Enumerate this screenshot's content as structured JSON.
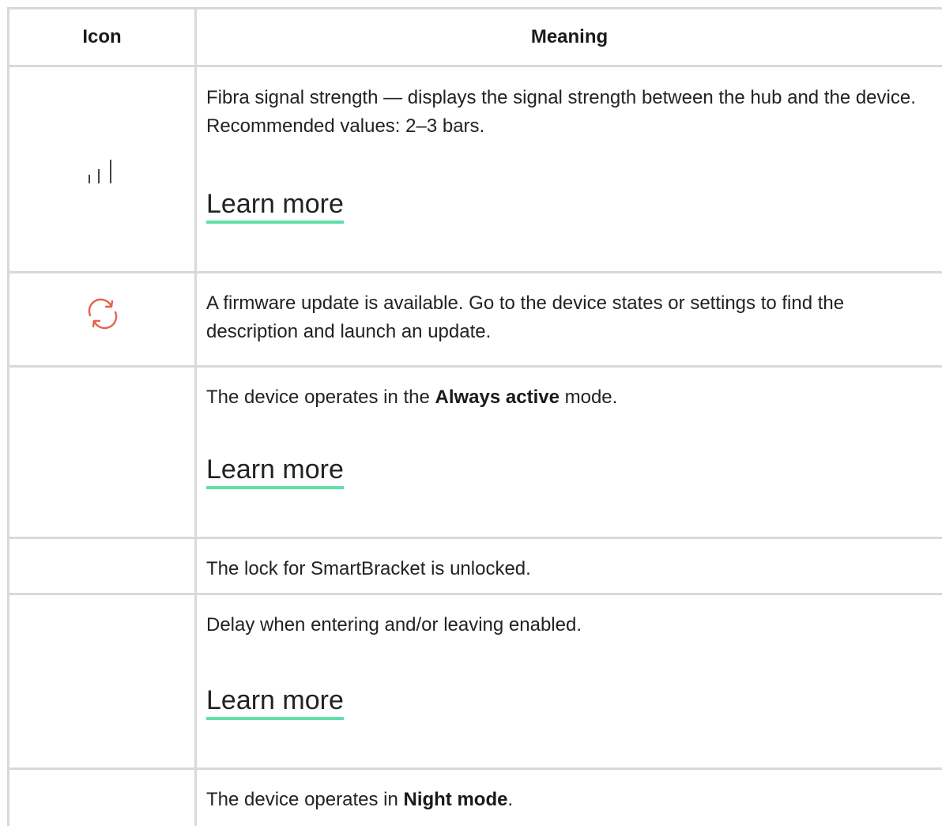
{
  "table": {
    "headers": {
      "icon": "Icon",
      "meaning": "Meaning"
    },
    "rows": [
      {
        "icon": "signal-strength-icon",
        "text": "Fibra signal strength — displays the signal strength between the hub and the device. Recommended values: 2–3 bars.",
        "link": "Learn more"
      },
      {
        "icon": "firmware-update-icon",
        "text": "A firmware update is available. Go to the device states or settings to find the description and launch an update."
      },
      {
        "text_before": "The device operates in the ",
        "text_bold": "Always active",
        "text_after": " mode.",
        "link": "Learn more"
      },
      {
        "text": "The lock for SmartBracket is unlocked."
      },
      {
        "text": "Delay when entering and/or leaving enabled.",
        "link": "Learn more"
      },
      {
        "text_before": "The device operates in ",
        "text_bold": "Night mode",
        "text_after": "."
      }
    ]
  },
  "colors": {
    "border": "#d9d9d9",
    "link_underline": "#5fe0a9",
    "update_icon": "#e8604c"
  }
}
